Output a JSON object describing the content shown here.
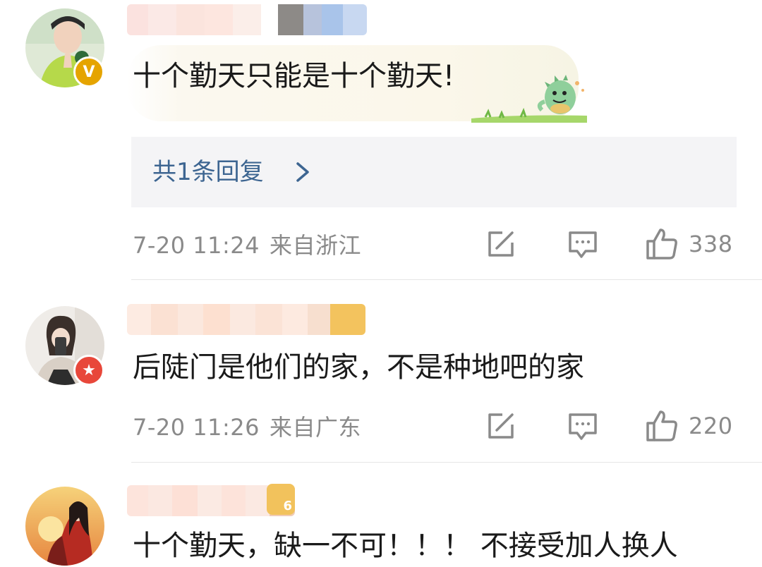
{
  "comments": [
    {
      "text": "十个勤天只能是十个勤天!",
      "replies_label": "共1条回复",
      "time": "7-20 11:24",
      "location": "来自浙江",
      "likes": "338",
      "badge": "V",
      "badge_color": "#e5a400"
    },
    {
      "text": "后陡门是他们的家，不是种地吧的家",
      "time": "7-20 11:26",
      "location": "来自广东",
      "likes": "220",
      "badge": "★",
      "badge_color": "#e8473a"
    },
    {
      "text": "十个勤天，缺一不可！！！ 不接受加人换人",
      "level_badge": "6"
    }
  ],
  "icons": {
    "repost": "repost-icon",
    "comment": "comment-icon",
    "like": "thumbs-up-icon",
    "chevron": "chevron-right-icon"
  }
}
